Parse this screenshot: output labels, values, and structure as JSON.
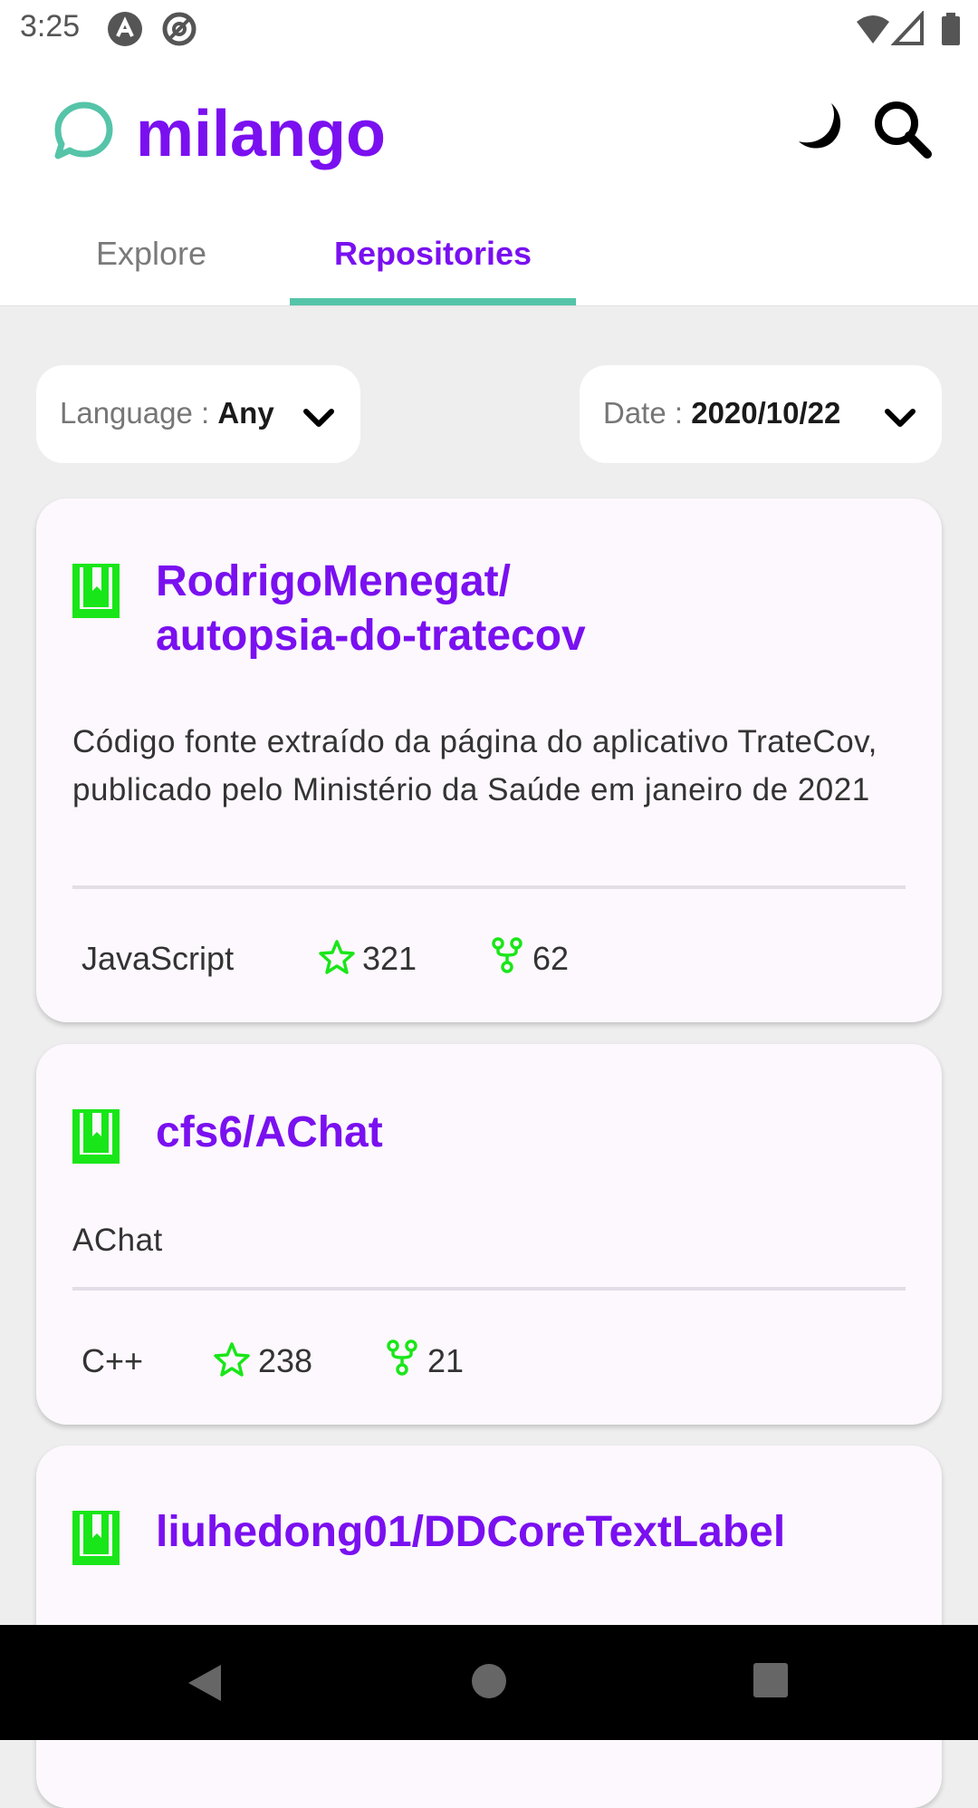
{
  "status_bar": {
    "time": "3:25"
  },
  "app": {
    "title": "milango"
  },
  "tabs": [
    {
      "label": "Explore",
      "selected": false
    },
    {
      "label": "Repositories",
      "selected": true
    }
  ],
  "filters": {
    "language": {
      "label": "Language : ",
      "value": "Any"
    },
    "date": {
      "label": "Date : ",
      "value": "2020/10/22"
    }
  },
  "repositories": [
    {
      "name_line1": "RodrigoMenegat/",
      "name_line2": "autopsia-do-tratecov",
      "description": "Código fonte extraído da página do aplicativo TrateCov, publicado pelo Ministério da Saúde em janeiro de 2021",
      "language": "JavaScript",
      "stars": "321",
      "forks": "62"
    },
    {
      "name": "cfs6/AChat",
      "description": "AChat",
      "language": "C++",
      "stars": "238",
      "forks": "21"
    },
    {
      "name": "liuhedong01/DDCoreTextLabel"
    }
  ],
  "colors": {
    "accent": "#7a10f0",
    "tab_indicator": "#55c4a8",
    "icon_green": "#19e619"
  },
  "icons": [
    "chat-bubble-icon",
    "moon-icon",
    "search-icon",
    "chevron-down-icon",
    "repo-book-icon",
    "star-icon",
    "fork-icon"
  ]
}
